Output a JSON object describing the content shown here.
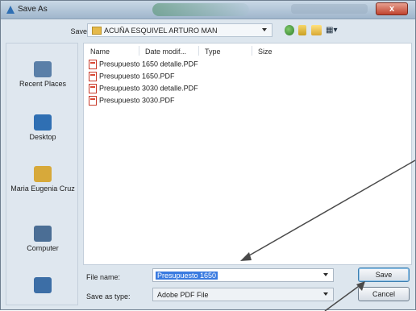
{
  "dialog": {
    "title": "Save As"
  },
  "save_in": {
    "label": "Save in:",
    "folder": "ACUÑA ESQUIVEL ARTURO MAN"
  },
  "toolbar": {
    "views_label": "▦▾"
  },
  "places": [
    {
      "label": "Recent Places",
      "icon": "recent-places-icon",
      "color": "#5a7fa8"
    },
    {
      "label": "Desktop",
      "icon": "desktop-icon",
      "color": "#2f6fb3"
    },
    {
      "label": "Maria Eugenia Cruz",
      "icon": "user-folder-icon",
      "color": "#d7a93a"
    },
    {
      "label": "Computer",
      "icon": "computer-icon",
      "color": "#4b6e95"
    },
    {
      "label": "",
      "icon": "network-icon",
      "color": "#3c6ea6"
    }
  ],
  "columns": [
    "Name",
    "Date modif...",
    "Type",
    "Size"
  ],
  "files": [
    "Presupuesto 1650 detalle.PDF",
    "Presupuesto 1650.PDF",
    "Presupuesto 3030 detalle.PDF",
    "Presupuesto 3030.PDF"
  ],
  "file_name": {
    "label": "File name:",
    "value": "Presupuesto 1650"
  },
  "save_as_type": {
    "label": "Save as type:",
    "value": "Adobe PDF File"
  },
  "buttons": {
    "save": "Save",
    "cancel": "Cancel"
  },
  "title_close": "x"
}
